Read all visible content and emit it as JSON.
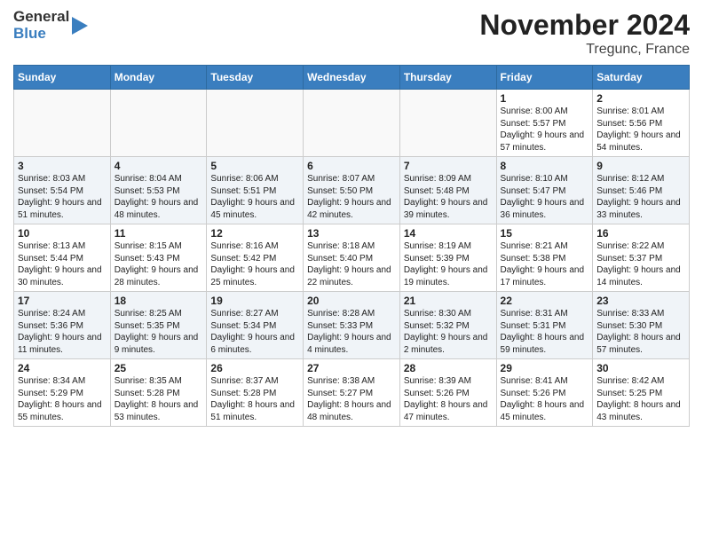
{
  "logo": {
    "line1": "General",
    "line2": "Blue"
  },
  "header": {
    "title": "November 2024",
    "subtitle": "Tregunc, France"
  },
  "weekdays": [
    "Sunday",
    "Monday",
    "Tuesday",
    "Wednesday",
    "Thursday",
    "Friday",
    "Saturday"
  ],
  "weeks": [
    [
      {
        "day": "",
        "info": ""
      },
      {
        "day": "",
        "info": ""
      },
      {
        "day": "",
        "info": ""
      },
      {
        "day": "",
        "info": ""
      },
      {
        "day": "",
        "info": ""
      },
      {
        "day": "1",
        "info": "Sunrise: 8:00 AM\nSunset: 5:57 PM\nDaylight: 9 hours and 57 minutes."
      },
      {
        "day": "2",
        "info": "Sunrise: 8:01 AM\nSunset: 5:56 PM\nDaylight: 9 hours and 54 minutes."
      }
    ],
    [
      {
        "day": "3",
        "info": "Sunrise: 8:03 AM\nSunset: 5:54 PM\nDaylight: 9 hours and 51 minutes."
      },
      {
        "day": "4",
        "info": "Sunrise: 8:04 AM\nSunset: 5:53 PM\nDaylight: 9 hours and 48 minutes."
      },
      {
        "day": "5",
        "info": "Sunrise: 8:06 AM\nSunset: 5:51 PM\nDaylight: 9 hours and 45 minutes."
      },
      {
        "day": "6",
        "info": "Sunrise: 8:07 AM\nSunset: 5:50 PM\nDaylight: 9 hours and 42 minutes."
      },
      {
        "day": "7",
        "info": "Sunrise: 8:09 AM\nSunset: 5:48 PM\nDaylight: 9 hours and 39 minutes."
      },
      {
        "day": "8",
        "info": "Sunrise: 8:10 AM\nSunset: 5:47 PM\nDaylight: 9 hours and 36 minutes."
      },
      {
        "day": "9",
        "info": "Sunrise: 8:12 AM\nSunset: 5:46 PM\nDaylight: 9 hours and 33 minutes."
      }
    ],
    [
      {
        "day": "10",
        "info": "Sunrise: 8:13 AM\nSunset: 5:44 PM\nDaylight: 9 hours and 30 minutes."
      },
      {
        "day": "11",
        "info": "Sunrise: 8:15 AM\nSunset: 5:43 PM\nDaylight: 9 hours and 28 minutes."
      },
      {
        "day": "12",
        "info": "Sunrise: 8:16 AM\nSunset: 5:42 PM\nDaylight: 9 hours and 25 minutes."
      },
      {
        "day": "13",
        "info": "Sunrise: 8:18 AM\nSunset: 5:40 PM\nDaylight: 9 hours and 22 minutes."
      },
      {
        "day": "14",
        "info": "Sunrise: 8:19 AM\nSunset: 5:39 PM\nDaylight: 9 hours and 19 minutes."
      },
      {
        "day": "15",
        "info": "Sunrise: 8:21 AM\nSunset: 5:38 PM\nDaylight: 9 hours and 17 minutes."
      },
      {
        "day": "16",
        "info": "Sunrise: 8:22 AM\nSunset: 5:37 PM\nDaylight: 9 hours and 14 minutes."
      }
    ],
    [
      {
        "day": "17",
        "info": "Sunrise: 8:24 AM\nSunset: 5:36 PM\nDaylight: 9 hours and 11 minutes."
      },
      {
        "day": "18",
        "info": "Sunrise: 8:25 AM\nSunset: 5:35 PM\nDaylight: 9 hours and 9 minutes."
      },
      {
        "day": "19",
        "info": "Sunrise: 8:27 AM\nSunset: 5:34 PM\nDaylight: 9 hours and 6 minutes."
      },
      {
        "day": "20",
        "info": "Sunrise: 8:28 AM\nSunset: 5:33 PM\nDaylight: 9 hours and 4 minutes."
      },
      {
        "day": "21",
        "info": "Sunrise: 8:30 AM\nSunset: 5:32 PM\nDaylight: 9 hours and 2 minutes."
      },
      {
        "day": "22",
        "info": "Sunrise: 8:31 AM\nSunset: 5:31 PM\nDaylight: 8 hours and 59 minutes."
      },
      {
        "day": "23",
        "info": "Sunrise: 8:33 AM\nSunset: 5:30 PM\nDaylight: 8 hours and 57 minutes."
      }
    ],
    [
      {
        "day": "24",
        "info": "Sunrise: 8:34 AM\nSunset: 5:29 PM\nDaylight: 8 hours and 55 minutes."
      },
      {
        "day": "25",
        "info": "Sunrise: 8:35 AM\nSunset: 5:28 PM\nDaylight: 8 hours and 53 minutes."
      },
      {
        "day": "26",
        "info": "Sunrise: 8:37 AM\nSunset: 5:28 PM\nDaylight: 8 hours and 51 minutes."
      },
      {
        "day": "27",
        "info": "Sunrise: 8:38 AM\nSunset: 5:27 PM\nDaylight: 8 hours and 48 minutes."
      },
      {
        "day": "28",
        "info": "Sunrise: 8:39 AM\nSunset: 5:26 PM\nDaylight: 8 hours and 47 minutes."
      },
      {
        "day": "29",
        "info": "Sunrise: 8:41 AM\nSunset: 5:26 PM\nDaylight: 8 hours and 45 minutes."
      },
      {
        "day": "30",
        "info": "Sunrise: 8:42 AM\nSunset: 5:25 PM\nDaylight: 8 hours and 43 minutes."
      }
    ]
  ]
}
